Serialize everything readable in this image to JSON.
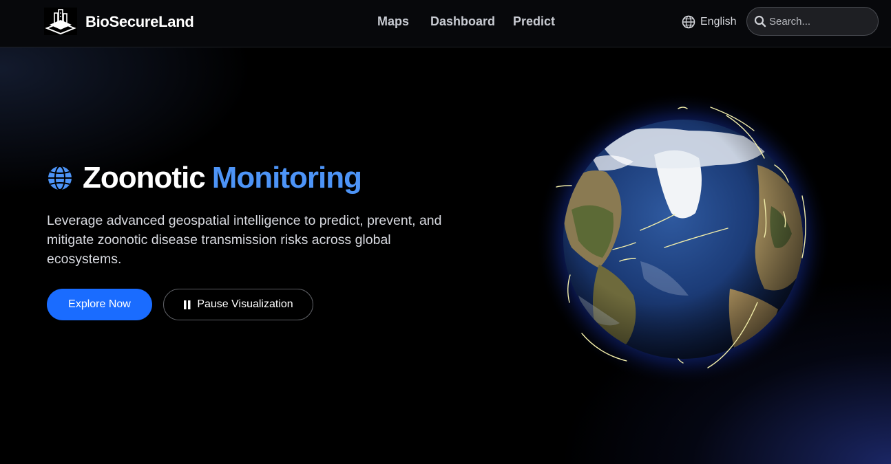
{
  "header": {
    "brand": "BioSecureLand",
    "nav": [
      {
        "label": "Maps"
      },
      {
        "label": "Dashboard"
      },
      {
        "label": "Predict"
      }
    ],
    "language": "English",
    "search": {
      "placeholder": "Search..."
    }
  },
  "hero": {
    "title_main": "Zoonotic",
    "title_accent": "Monitoring",
    "subtitle": "Leverage advanced geospatial intelligence to predict, prevent, and mitigate zoonotic disease transmission risks across global ecosystems.",
    "primary_button": "Explore Now",
    "secondary_button": "Pause Visualization"
  },
  "icons": {
    "logo": "building-logo-icon",
    "language": "globe-icon",
    "search": "search-icon",
    "title": "globe-icon",
    "pause": "pause-icon"
  },
  "colors": {
    "accent": "#4d94f7",
    "primary_button": "#1a6cff",
    "background": "#000000",
    "arc": "#f2eeaa"
  }
}
